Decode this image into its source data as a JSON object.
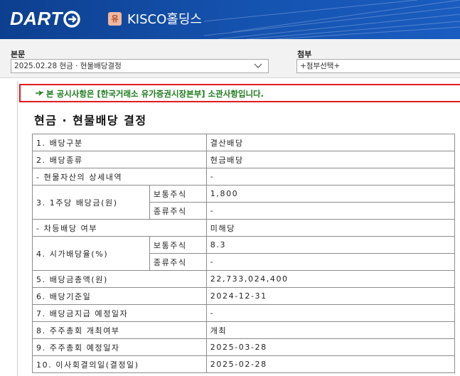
{
  "header": {
    "logo_text": "DART",
    "market_badge": "유",
    "company_name": "KISCO홀딩스",
    "colors": {
      "bg": "#1553b0",
      "badge": "#f0b8a0"
    }
  },
  "controls": {
    "main_label": "본문",
    "main_selected": "2025.02.28  현금 · 현물배당결정",
    "attach_label": "첨부",
    "attach_selected": "+첨부선택+"
  },
  "notice": {
    "icon": "pointing-hand-icon",
    "text": "본 공시사항은 [한국거래소 유가증권시장본부] 소관사항입니다."
  },
  "document": {
    "title": "현금 · 현물배당 결정",
    "rows": {
      "r1": {
        "label": "1. 배당구분",
        "value": "결산배당"
      },
      "r2": {
        "label": "2. 배당종류",
        "value": "현금배당"
      },
      "r3": {
        "label": "- 현물자산의 상세내역",
        "value": "-"
      },
      "r4": {
        "label": "3. 1주당 배당금(원)",
        "sub1": "보통주식",
        "val1": "1,800",
        "sub2": "종류주식",
        "val2": "-"
      },
      "r5": {
        "label": "- 차등배당 여부",
        "value": "미해당"
      },
      "r6": {
        "label": "4. 시가배당율(%)",
        "sub1": "보통주식",
        "val1": "8.3",
        "sub2": "종류주식",
        "val2": "-"
      },
      "r7": {
        "label": "5. 배당금총액(원)",
        "value": "22,733,024,400"
      },
      "r8": {
        "label": "6. 배당기준일",
        "value": "2024-12-31"
      },
      "r9": {
        "label": "7. 배당금지급 예정일자",
        "value": "-"
      },
      "r10": {
        "label": "8. 주주총회 개최여부",
        "value": "개최"
      },
      "r11": {
        "label": "9. 주주총회 예정일자",
        "value": "2025-03-28"
      },
      "r12": {
        "label": "10. 이사회결의일(결정일)",
        "value": "2025-02-28"
      }
    }
  }
}
